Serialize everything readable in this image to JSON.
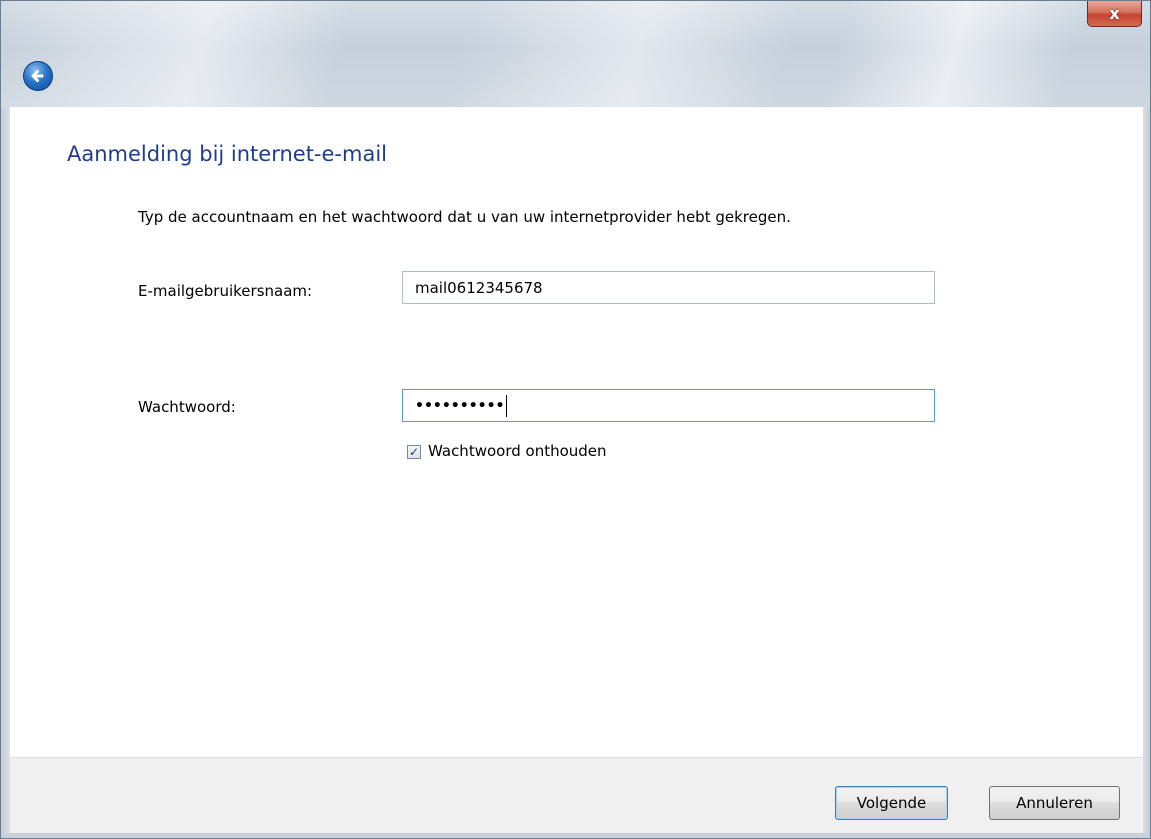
{
  "window": {
    "close_glyph": "x",
    "back_icon": "back-arrow-icon"
  },
  "wizard": {
    "heading": "Aanmelding bij internet-e-mail",
    "instruction": "Typ de accountnaam en het wachtwoord dat u van uw internetprovider hebt gekregen.",
    "username_label": "E-mailgebruikersnaam:",
    "username_value": "mail0612345678",
    "password_label": "Wachtwoord:",
    "password_value": "••••••••••",
    "remember_label": "Wachtwoord onthouden",
    "remember_checked": true
  },
  "footer": {
    "next_label": "Volgende",
    "cancel_label": "Annuleren"
  },
  "colors": {
    "heading": "#1e3d8f",
    "close_button": "#c2432f",
    "accent": "#3c7fb1"
  }
}
